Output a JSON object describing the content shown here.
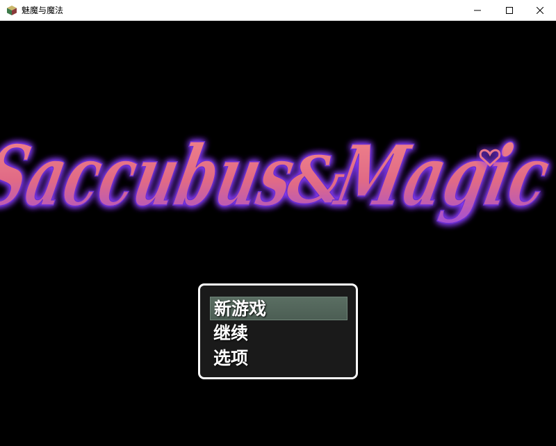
{
  "window": {
    "title": "魅魔与魔法",
    "icon": "app-icon"
  },
  "logo": {
    "text_main": "Saccubus",
    "text_amp": "&",
    "text_end": "Magic",
    "fill_color": "#e8707e",
    "glow_color": "#8a3cff"
  },
  "menu": {
    "items": [
      {
        "label": "新游戏",
        "selected": true
      },
      {
        "label": "继续",
        "selected": false
      },
      {
        "label": "选项",
        "selected": false
      }
    ]
  }
}
